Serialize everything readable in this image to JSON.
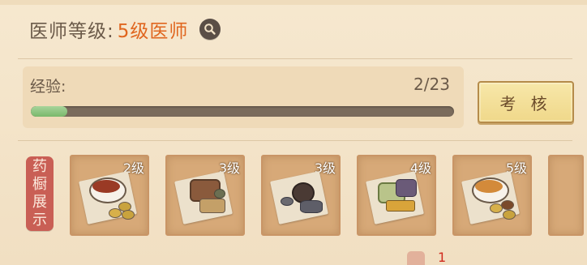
{
  "header": {
    "title_label": "医师等级:",
    "title_value": "5级医师"
  },
  "experience": {
    "label": "经验:",
    "current": 2,
    "max": 23,
    "count_text": "2/23",
    "progress_fraction": 0.087
  },
  "exam_button": {
    "label": "考 核"
  },
  "showcase": {
    "seal_chars": [
      "药",
      "橱",
      "展",
      "示"
    ],
    "items": [
      {
        "level": "2级",
        "icon": "herbal-tea-bowl-icon"
      },
      {
        "level": "3级",
        "icon": "herb-bundle-icon"
      },
      {
        "level": "3级",
        "icon": "herbal-pill-icon"
      },
      {
        "level": "4级",
        "icon": "mixed-herbs-icon"
      },
      {
        "level": "5级",
        "icon": "herbal-soup-bowl-icon"
      }
    ]
  },
  "footer": {
    "count": "1",
    "icon": "reward-icon"
  },
  "colors": {
    "accent_orange": "#e0661f",
    "progress_green": "#79b86b",
    "seal_red": "#c95f55",
    "button_gold": "#f0d88a"
  }
}
